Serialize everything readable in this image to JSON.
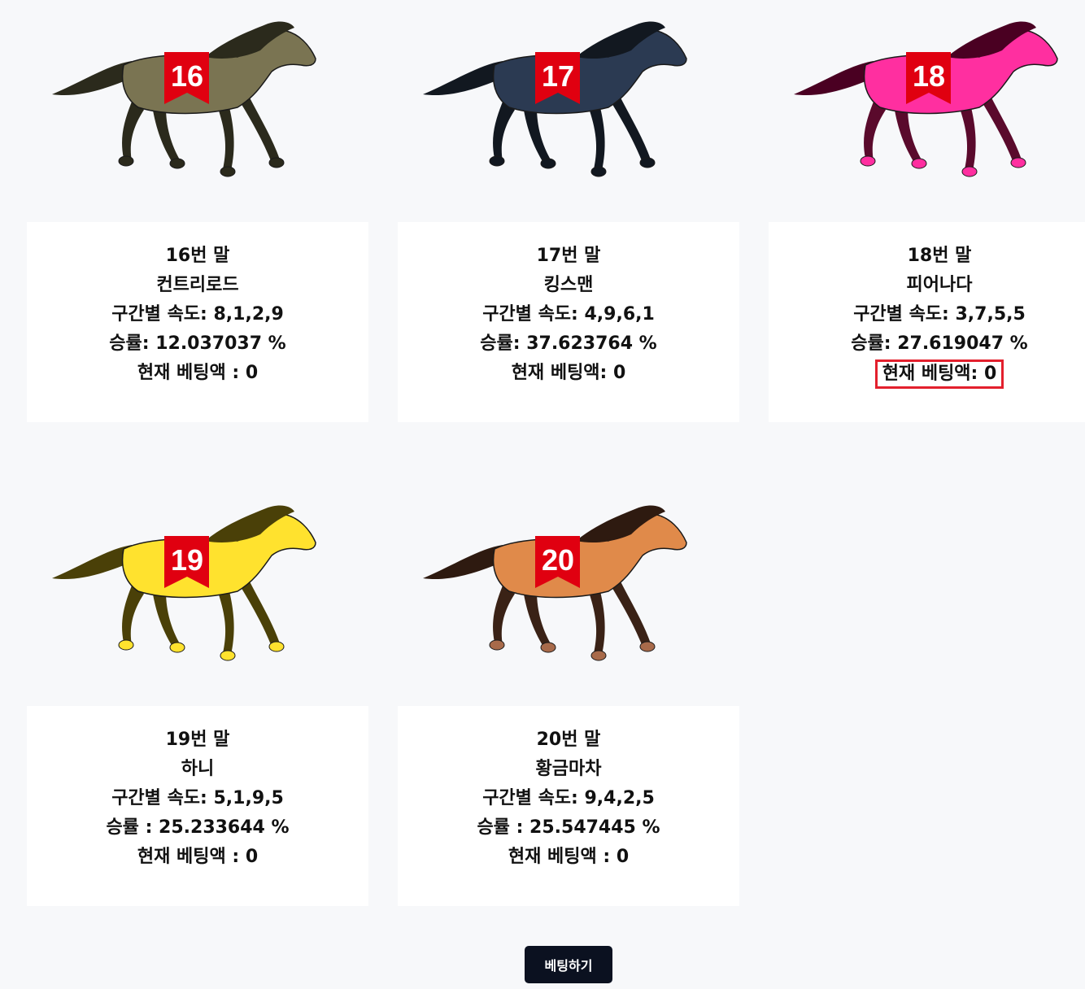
{
  "horses": [
    {
      "num": "16",
      "title": "16번 말",
      "name": "컨트리로드",
      "speed": "구간별 속도: 8,1,2,9",
      "winrate": "승률: 12.037037 %",
      "bet": "현재 베팅액 : 0",
      "body_color": "#7a7452",
      "mane_color": "#2b2a1c",
      "leg_color": "#2b2a1c",
      "hoof_color": "#2b2a1c"
    },
    {
      "num": "17",
      "title": "17번 말",
      "name": "킹스맨",
      "speed": "구간별 속도: 4,9,6,1",
      "winrate": "승률: 37.623764 %",
      "bet": "현재 베팅액: 0",
      "body_color": "#2b3a52",
      "mane_color": "#121820",
      "leg_color": "#121820",
      "hoof_color": "#121820"
    },
    {
      "num": "18",
      "title": "18번 말",
      "name": "피어나다",
      "speed": "구간별 속도: 3,7,5,5",
      "winrate": "승률: 27.619047 %",
      "bet": "현재 베팅액: 0",
      "body_color": "#ff2fa0",
      "mane_color": "#4a0022",
      "leg_color": "#5a0a2c",
      "hoof_color": "#ff2fa0"
    },
    {
      "num": "19",
      "title": "19번 말",
      "name": "하니",
      "speed": "구간별 속도: 5,1,9,5",
      "winrate": "승률 : 25.233644 %",
      "bet": "현재 베팅액 : 0",
      "body_color": "#ffe22e",
      "mane_color": "#4a4008",
      "leg_color": "#4a4008",
      "hoof_color": "#ffe22e"
    },
    {
      "num": "20",
      "title": "20번 말",
      "name": "황금마차",
      "speed": "구간별 속도: 9,4,2,5",
      "winrate": "승률 : 25.547445 %",
      "bet": "현재 베팅액 : 0",
      "body_color": "#e08a4a",
      "mane_color": "#2e1a10",
      "leg_color": "#3a2216",
      "hoof_color": "#a86a4a"
    }
  ],
  "bib_color": "#e00010",
  "highlight_color": "#e3202d",
  "bet_button": "베팅하기"
}
